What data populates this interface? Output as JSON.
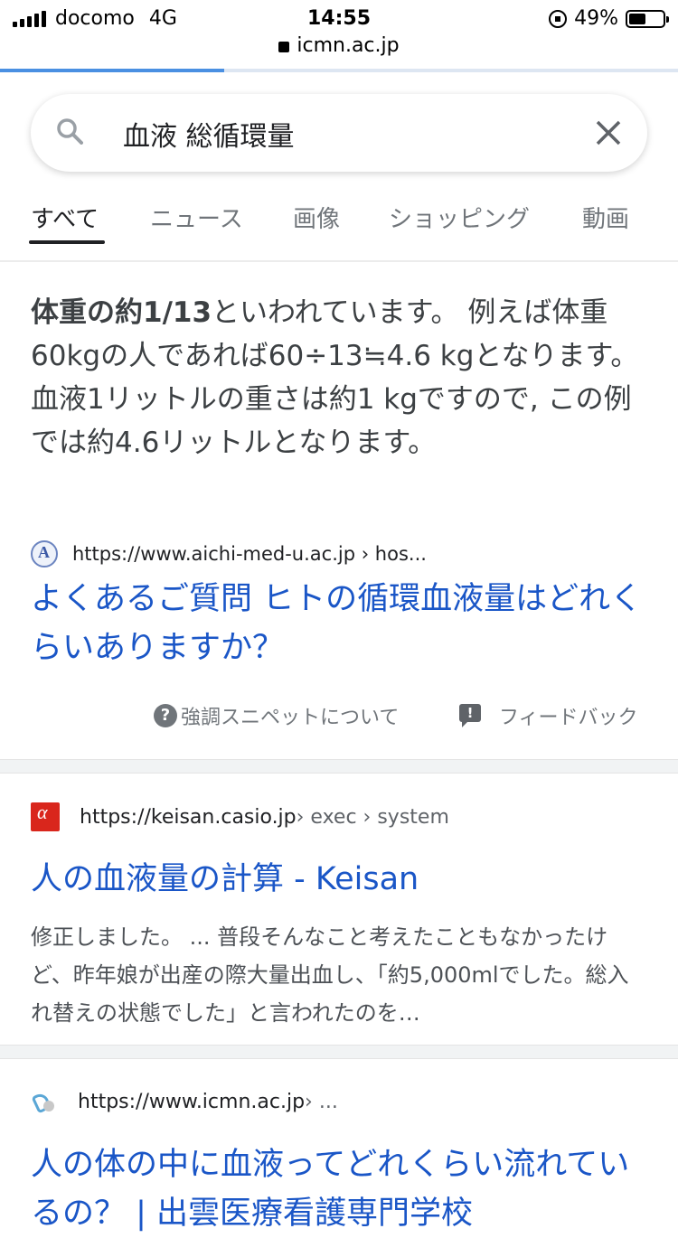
{
  "status_bar": {
    "carrier": "docomo",
    "network": "4G",
    "time": "14:55",
    "battery_percent": "49%"
  },
  "browser": {
    "domain": "icmn.ac.jp",
    "load_progress": 0.33
  },
  "search": {
    "query": "血液 総循環量"
  },
  "tabs": [
    {
      "label": "すべて",
      "active": true
    },
    {
      "label": "ニュース",
      "active": false
    },
    {
      "label": "画像",
      "active": false
    },
    {
      "label": "ショッピング",
      "active": false
    },
    {
      "label": "動画",
      "active": false
    }
  ],
  "featured_snippet": {
    "bold": "体重の約1/13",
    "text": "といわれています。 例えば体重60kgの人であれば60÷13≒4.6 kgとなります。 血液1リットルの重さは約1 kgですので, この例では約4.6リットルとなります。",
    "source_url": "https://www.aichi-med-u.ac.jp › hos...",
    "title": "よくあるご質問 ヒトの循環血液量はどれくらいありますか？",
    "about_label": "強調スニペットについて",
    "feedback_label": "フィードバック"
  },
  "results": [
    {
      "url": "https://keisan.casio.jp",
      "breadcrumb": " › exec › system",
      "title": "人の血液量の計算 - Keisan",
      "description": "修正しました。 ... 普段そんなこと考えたこともなかったけど、昨年娘が出産の際大量出血し、「約5,000mlでした。総入れ替えの状態でした」と言われたのを…",
      "favicon": "keisan-alpha-icon"
    },
    {
      "url": "https://www.icmn.ac.jp",
      "breadcrumb": " › ...",
      "title": "人の体の中に血液ってどれくらい流れているの？ | 出雲医療看護専門学校",
      "favicon": "icmn-logo-icon"
    }
  ],
  "colors": {
    "link_blue": "#1a56c7",
    "progress_blue": "#4a90e2",
    "keisan_red": "#d9261c"
  }
}
